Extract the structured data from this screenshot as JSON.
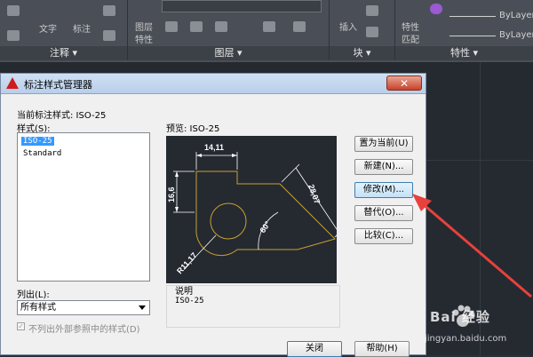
{
  "ribbon": {
    "groups": {
      "annotation": "注释 ▾",
      "layers": "图层 ▾",
      "block": "块 ▾",
      "properties": "特性 ▾"
    },
    "small_labels": {
      "text": "文字",
      "mark": "标注",
      "layer_props_1": "图层",
      "layer_props_2": "特性",
      "insert": "插入",
      "match_1": "特性",
      "match_2": "匹配"
    },
    "bylayer_1": "ByLayer",
    "bylayer_2": "ByLayer"
  },
  "dialog": {
    "title": "标注样式管理器",
    "close_glyph": "✕",
    "current_style_label": "当前标注样式: ISO-25",
    "styles_label": "样式(S):",
    "styles": [
      "ISO-25",
      "Standard"
    ],
    "selected_style": "ISO-25",
    "preview_label": "预览: ISO-25",
    "list_label": "列出(L):",
    "list_value": "所有样式",
    "exclude_xref_label": "不列出外部参照中的样式(D)",
    "description_label": "说明",
    "description_value": "ISO-25",
    "buttons": {
      "set_current": "置为当前(U)",
      "new": "新建(N)...",
      "modify": "修改(M)...",
      "override": "替代(O)...",
      "compare": "比较(C)...",
      "close": "关闭",
      "help": "帮助(H)"
    }
  },
  "preview": {
    "dim_top": "14,11",
    "dim_left": "16,6",
    "dim_diag": "28,07",
    "dim_angle": "60°",
    "dim_radius": "R11,17"
  },
  "watermark": {
    "brand": "Bai 经验",
    "url": "jingyan.baidu.com"
  },
  "colors": {
    "preview_line": "#c8a034",
    "dimension": "#ffffff",
    "arrow": "#e8413c",
    "selection": "#3399ff"
  }
}
